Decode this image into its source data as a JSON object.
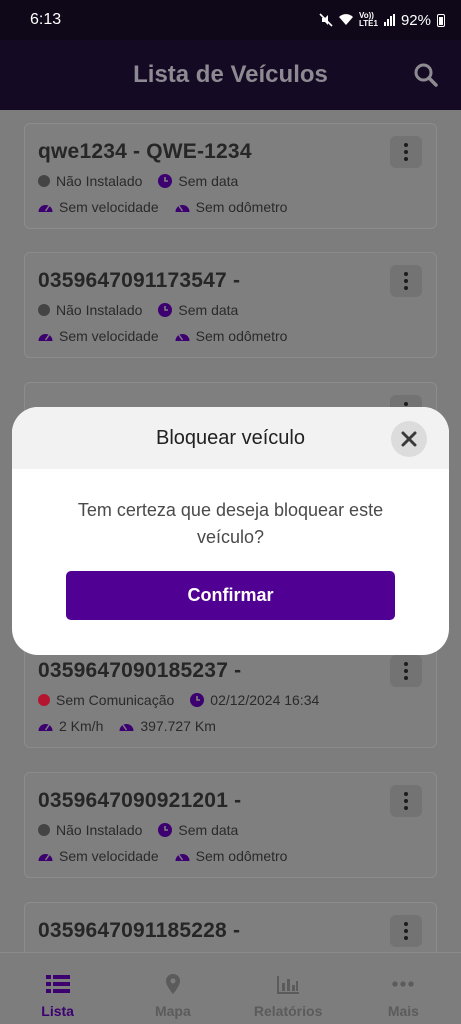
{
  "status_bar": {
    "time": "6:13",
    "network_top": "Vo))",
    "network_bottom": "LTE1",
    "battery": "92%"
  },
  "app_bar": {
    "title": "Lista de Veículos"
  },
  "vehicles": [
    {
      "title": "qwe1234 - QWE-1234",
      "status": "Não Instalado",
      "status_color": "#444444",
      "date": "Sem data",
      "speed": "Sem velocidade",
      "odometer": "Sem odômetro"
    },
    {
      "title": "0359647091173547 -",
      "status": "Não Instalado",
      "status_color": "#444444",
      "date": "Sem data",
      "speed": "Sem velocidade",
      "odometer": "Sem odômetro"
    },
    {
      "title": "0359647090185237 -",
      "status": "Sem Comunicação",
      "status_color": "#b3162e",
      "date": "02/12/2024 16:34",
      "speed": "2 Km/h",
      "odometer": "397.727 Km"
    },
    {
      "title": "0359647090921201 -",
      "status": "Não Instalado",
      "status_color": "#444444",
      "date": "Sem data",
      "speed": "Sem velocidade",
      "odometer": "Sem odômetro"
    },
    {
      "title": "0359647091185228 -"
    }
  ],
  "dialog": {
    "title": "Bloquear veículo",
    "message": "Tem certeza que deseja bloquear este veículo?",
    "confirm_label": "Confirmar"
  },
  "bottom_nav": [
    {
      "label": "Lista",
      "icon": "list-icon",
      "active": true
    },
    {
      "label": "Mapa",
      "icon": "map-pin-icon",
      "active": false
    },
    {
      "label": "Relatórios",
      "icon": "bar-chart-icon",
      "active": false
    },
    {
      "label": "Mais",
      "icon": "more-dots-icon",
      "active": false
    }
  ],
  "colors": {
    "accent": "#500092",
    "app_bar": "#150a24",
    "scrim": "#7d7d7d"
  }
}
